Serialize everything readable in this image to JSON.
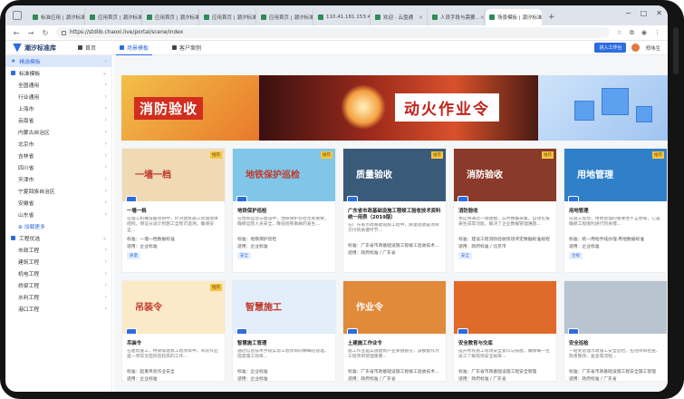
{
  "browser": {
    "tabs": [
      {
        "label": "标准应用 | 潮汐标准..."
      },
      {
        "label": "应用首页 | 潮汐标准..."
      },
      {
        "label": "应用首页 | 潮汐标准..."
      },
      {
        "label": "应用首页 | 潮汐标准..."
      },
      {
        "label": "应用首页 | 潮汐标准..."
      },
      {
        "label": "110.41.181.153:43..."
      },
      {
        "label": "欢迎 - 云盘通"
      },
      {
        "label": "人员字段与需要..."
      },
      {
        "label": "场景模板 | 潮汐标准..."
      }
    ],
    "url": "https://stdlib.chaoxi.live/portal/scene/index"
  },
  "app": {
    "logo_text": "潮汐标准库",
    "nav": [
      {
        "label": "首页"
      },
      {
        "label": "场景模板"
      },
      {
        "label": "客户案例"
      }
    ],
    "enter_button": "进入工作台",
    "user_name": "郑伟生"
  },
  "sidebar": {
    "quick_title": "精选模板",
    "group1_title": "标准模板",
    "group1_items": [
      "全国通用",
      "行业通用",
      "上海市",
      "云南省",
      "内蒙古自治区",
      "北京市",
      "吉林省",
      "四川省",
      "天津市",
      "宁夏回族自治区",
      "安徽省",
      "山东省"
    ],
    "group1_more": "⊕ 加载更多",
    "group2_title": "工程优选",
    "group2_items": [
      "市政工程",
      "建筑工程",
      "机电工程",
      "桥梁工程",
      "水利工程",
      "港口工程"
    ]
  },
  "banner": {
    "left_text": "消防验收",
    "mid_text": "动火作业令"
  },
  "cards": [
    {
      "img_text": "一墙一档",
      "title": "一墙一档",
      "desc": "在施工机械设备项目中，针对建筑施工管理墙体结构，保证从设计到施工全程可追溯，确保安全...",
      "m1": "标准：一墙一档数据标准",
      "m2": "适用：企业标准",
      "tag": "质量",
      "badge": "推荐",
      "bg": "#f0d9b5"
    },
    {
      "img_text": "地铁保护巡检",
      "title": "地铁保护巡检",
      "desc": "在地铁运营与建设中，地铁保护巡检至关重要，确保运营人员安全，降低地铁事故的发生...",
      "m1": "标准：地铁保护巡检",
      "m2": "适用：企业标准",
      "tag": "安全",
      "badge": "推荐",
      "bg": "#7fc6e8"
    },
    {
      "img_text": "质量验收",
      "title": "广东省市政基础设施工程竣工验收技术资料统一用表（2019版）",
      "desc": "在广东省市政基础设施工程中，质量验收是项目交付的关键环节...",
      "m1": "标准：广东省市政基础设施工程竣工验收技术...",
      "m2": "适用：政府标准 / 广东省",
      "tag": "",
      "badge": "推荐",
      "bg": "#3a5a7a"
    },
    {
      "img_text": "消防验收",
      "title": "消防验收",
      "desc": "本应用通过一键建模，实时数据采集，自动化报表生成等功能，解决了企业数据管理难题...",
      "m1": "标准：建设工程消防验收现场评定数据标准规程",
      "m2": "适用：政府标准 / 北京市",
      "tag": "安全",
      "badge": "推荐",
      "bg": "#8a3a2a"
    },
    {
      "img_text": "用地管理",
      "title": "用地管理",
      "desc": "在施工现场，用地管理的重要性不言而喻，它是确保工程顺利进行的关键...",
      "m1": "标准：统一用地手续办理·用地数据标准",
      "m2": "适用：企业标准",
      "tag": "合规",
      "badge": "推荐",
      "bg": "#2f80c8"
    },
    {
      "img_text": "吊装令",
      "title": "吊装令",
      "desc": "在建筑施工，桥梁等建筑工程项目中，吊装作业是一项常见但风险较高的工作...",
      "m1": "标准：起重吊装作业安全",
      "m2": "适用：企业标准",
      "tag": "",
      "badge": "推荐",
      "bg": "#fbe9c8"
    },
    {
      "img_text": "智慧施工",
      "title": "智慧施工管理",
      "desc": "通过信息技术手段实现工程项目的精细化管理，提高施工效率...",
      "m1": "标准：企业标准",
      "m2": "适用：企业标准",
      "tag": "",
      "badge": "",
      "bg": "#e3eefb"
    },
    {
      "img_text": "作业令",
      "title": "土建施工作业令",
      "desc": "施工作业是实施建筑产业关键部分，该模板作为工程项目管理重要...",
      "m1": "标准：广东省市政基础设施工程竣工验收技术...",
      "m2": "适用：政府标准 / 广东省",
      "tag": "",
      "badge": "",
      "bg": "#e08a3a"
    },
    {
      "img_text": "",
      "title": "安全教育与交底",
      "desc": "提升所有施工现场安全意识与技能，确保每一位员工了解现场安全规章...",
      "m1": "标准：广东省市政基础设施工程安全管理",
      "m2": "适用：政府标准 / 广东省",
      "tag": "",
      "badge": "",
      "bg": "#e06a2a"
    },
    {
      "img_text": "",
      "title": "安全巡检",
      "desc": "一站式管理市政施工安全巡检，包括项目检查、隐患整改、复查等流程...",
      "m1": "标准：广东省市政基础设施工程安全施工管理",
      "m2": "适用：政府标准 / 广东省",
      "tag": "",
      "badge": "",
      "bg": "#b8c4d0"
    }
  ]
}
